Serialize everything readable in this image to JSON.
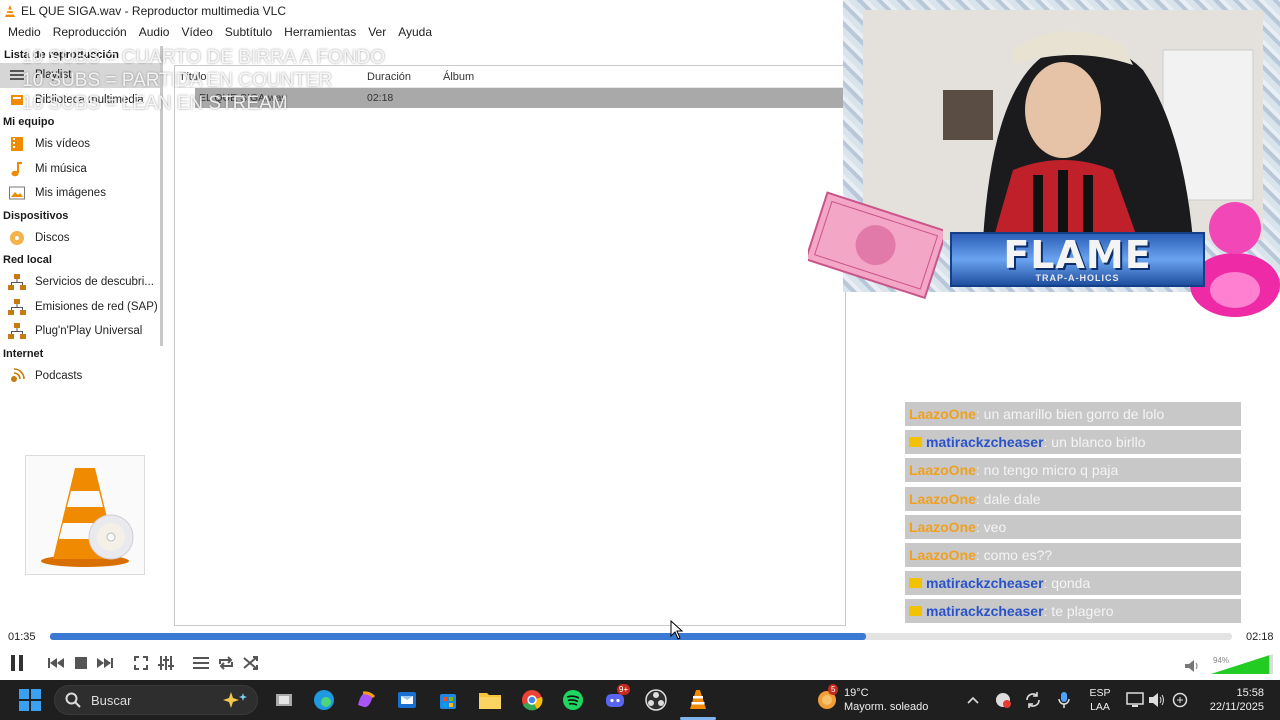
{
  "window": {
    "title": "EL QUE SIGA.wav - Reproductor multimedia VLC"
  },
  "menu": [
    "Medio",
    "Reproducción",
    "Audio",
    "Vídeo",
    "Subtítulo",
    "Herramientas",
    "Ver",
    "Ayuda"
  ],
  "overlay": {
    "lines": [
      "10 SUBS = CUARTO DE BIRRA A FONDO",
      "10 SUBS = PARTIDA EN COUNTER",
      "10 SUBS = LEAN EN STREAM"
    ]
  },
  "sidebar": {
    "header": "Lista de reproducción",
    "top_items": [
      {
        "label": "Playlist",
        "icon": "playlist-icon"
      },
      {
        "label": "Biblioteca multimedia",
        "icon": "library-icon"
      }
    ],
    "categories": [
      {
        "title": "Mi equipo",
        "items": [
          {
            "label": "Mis vídeos",
            "icon": "videos-icon"
          },
          {
            "label": "Mi música",
            "icon": "music-icon"
          },
          {
            "label": "Mis imágenes",
            "icon": "images-icon"
          }
        ]
      },
      {
        "title": "Dispositivos",
        "items": [
          {
            "label": "Discos",
            "icon": "disc-icon"
          }
        ]
      },
      {
        "title": "Red local",
        "items": [
          {
            "label": "Servicios de descubri...",
            "icon": "network-icon"
          },
          {
            "label": "Emisiones de red (SAP)",
            "icon": "network-icon"
          },
          {
            "label": "Plug'n'Play Universal",
            "icon": "network-icon"
          }
        ]
      },
      {
        "title": "Internet",
        "items": [
          {
            "label": "Podcasts",
            "icon": "podcast-icon"
          }
        ]
      }
    ]
  },
  "playlist": {
    "columns": {
      "title": "Título",
      "duration": "Duración",
      "album": "Álbum"
    },
    "rows": [
      {
        "title": "EL QUE SIGA.wav",
        "duration": "02:18",
        "album": ""
      }
    ]
  },
  "stream": {
    "banner_title": "FLAME",
    "banner_subtitle": "TRAP-A-HOLICS"
  },
  "chat": [
    {
      "user": "LaazoOne",
      "msg": ": un amarillo bien gorro de lolo",
      "color": "#f0a020",
      "badge": false
    },
    {
      "user": "matirackzcheaser",
      "msg": ": un blanco birllo",
      "color": "#2a52c9",
      "badge": true
    },
    {
      "user": "LaazoOne",
      "msg": ": no tengo micro q paja",
      "color": "#f0a020",
      "badge": false
    },
    {
      "user": "LaazoOne",
      "msg": ": dale dale",
      "color": "#f0a020",
      "badge": false
    },
    {
      "user": "LaazoOne",
      "msg": ": veo",
      "color": "#f0a020",
      "badge": false
    },
    {
      "user": "LaazoOne",
      "msg": ": como es??",
      "color": "#f0a020",
      "badge": false
    },
    {
      "user": "matirackzcheaser",
      "msg": ": qonda",
      "color": "#2a52c9",
      "badge": true
    },
    {
      "user": "matirackzcheaser",
      "msg": ": te plagero",
      "color": "#2a52c9",
      "badge": true
    }
  ],
  "player": {
    "current_time": "01:35",
    "total_time": "02:18",
    "progress": 0.69,
    "volume": "94%",
    "volume_level": 0.94
  },
  "taskbar": {
    "search_placeholder": "Buscar",
    "weather": {
      "temp": "19°C",
      "desc": "Mayorm. soleado"
    },
    "lang": {
      "line1": "ESP",
      "line2": "LAA"
    },
    "clock": {
      "time": "15:58",
      "date": "22/11/2025"
    },
    "weather_badge": "5",
    "discord_badge": "9+"
  },
  "colors": {
    "accent": "#3a7ad5",
    "vlc_orange": "#f08a00",
    "taskbar": "#1f1f1f"
  }
}
